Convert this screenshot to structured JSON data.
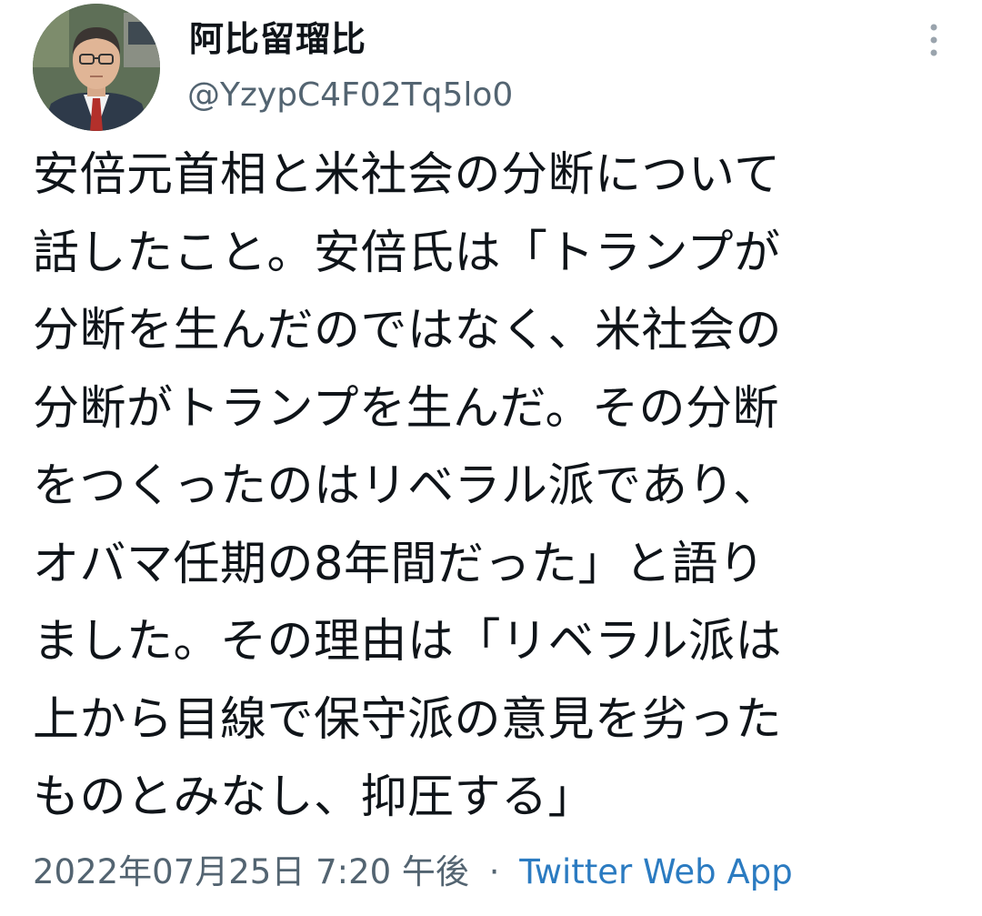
{
  "tweet": {
    "display_name": "阿比留瑠比",
    "handle": "@YzypC4F02Tq5lo0",
    "more_icon": "more-vertical-icon",
    "avatar_icon": "avatar-photo",
    "lines": [
      "安倍元首相と米社会の分断について",
      "話したこと。安倍氏は「トランプが",
      "分断を生んだのではなく、米社会の",
      "分断がトランプを生んだ。その分断",
      "をつくったのはリベラル派であり、",
      "オバマ任期の8年間だった」と語り",
      "ました。その理由は「リベラル派は",
      "上から目線で保守派の意見を劣った",
      "ものとみなし、抑圧する」"
    ],
    "timestamp": "2022年07月25日 7:20 午後",
    "separator": "·",
    "source": "Twitter Web App",
    "colors": {
      "text": "#0f1419",
      "secondary": "#536471",
      "link": "#2b7bc1"
    }
  }
}
